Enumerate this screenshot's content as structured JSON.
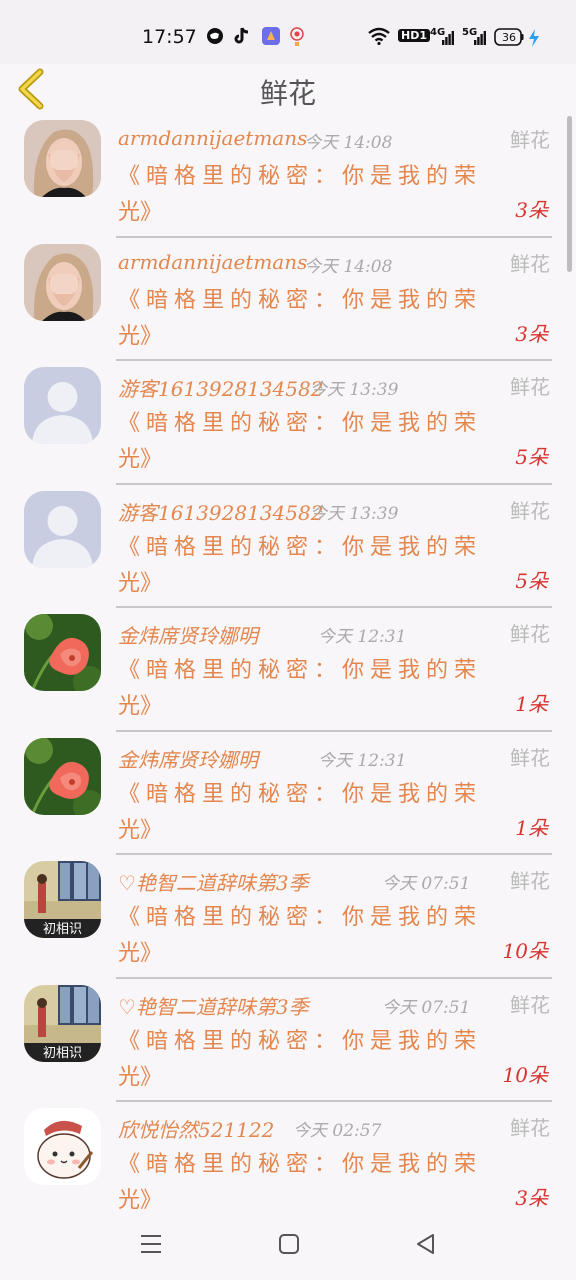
{
  "status_bar": {
    "time": "17:57",
    "hd_label": "HD1",
    "net1": "4G",
    "net2": "5G",
    "battery": "36"
  },
  "header": {
    "title": "鲜花"
  },
  "rows": [
    {
      "name": "armdannijaetmans",
      "time": "今天 14:08",
      "label": "鲜花",
      "msg1": "《暗格里的秘密：你是我的荣",
      "msg2": "光》",
      "count": "3朵",
      "avatar": "woman"
    },
    {
      "name": "armdannijaetmans",
      "time": "今天 14:08",
      "label": "鲜花",
      "msg1": "《暗格里的秘密：你是我的荣",
      "msg2": "光》",
      "count": "3朵",
      "avatar": "woman"
    },
    {
      "name": "游客1613928134582",
      "time": "今天 13:39",
      "label": "鲜花",
      "msg1": "《暗格里的秘密：你是我的荣",
      "msg2": "光》",
      "count": "5朵",
      "avatar": "default"
    },
    {
      "name": "游客1613928134582",
      "time": "今天 13:39",
      "label": "鲜花",
      "msg1": "《暗格里的秘密：你是我的荣",
      "msg2": "光》",
      "count": "5朵",
      "avatar": "default"
    },
    {
      "name": "金炜席贤玲娜明",
      "time": "今天 12:31",
      "label": "鲜花",
      "msg1": "《暗格里的秘密：你是我的荣",
      "msg2": "光》",
      "count": "1朵",
      "avatar": "flower"
    },
    {
      "name": "金炜席贤玲娜明",
      "time": "今天 12:31",
      "label": "鲜花",
      "msg1": "《暗格里的秘密：你是我的荣",
      "msg2": "光》",
      "count": "1朵",
      "avatar": "flower"
    },
    {
      "name": "♡艳智二道辞味第3季",
      "time": "今天 07:51",
      "label": "鲜花",
      "msg1": "《暗格里的秘密：你是我的荣",
      "msg2": "光》",
      "count": "10朵",
      "avatar": "room",
      "avatar_text": "初相识"
    },
    {
      "name": "♡艳智二道辞味第3季",
      "time": "今天 07:51",
      "label": "鲜花",
      "msg1": "《暗格里的秘密：你是我的荣",
      "msg2": "光》",
      "count": "10朵",
      "avatar": "room",
      "avatar_text": "初相识"
    },
    {
      "name": "欣悦怡然521122",
      "time": "今天 02:57",
      "label": "鲜花",
      "msg1": "《暗格里的秘密：你是我的荣",
      "msg2": "光》",
      "count": "3朵",
      "avatar": "bear"
    }
  ],
  "time_offsets": [
    304,
    304,
    310,
    310,
    318,
    318,
    382,
    382,
    293
  ]
}
